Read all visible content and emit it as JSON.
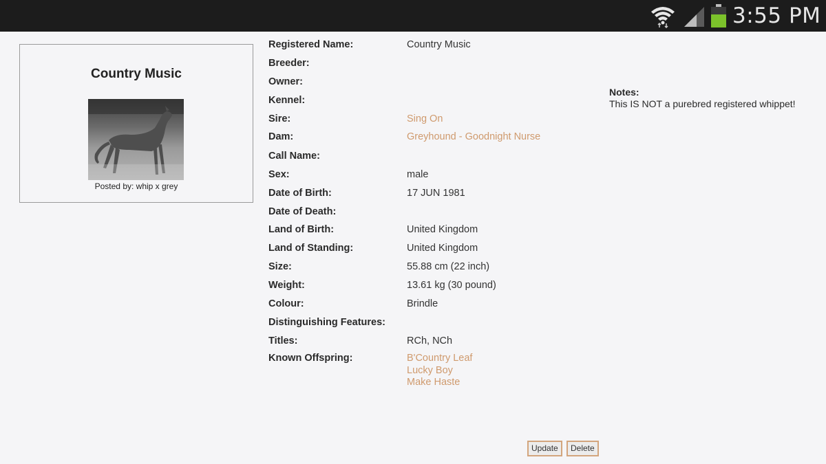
{
  "status_bar": {
    "time": "3:55 PM",
    "icons": [
      "wifi-icon",
      "signal-icon",
      "battery-icon"
    ],
    "battery_color": "#7cc22b"
  },
  "photo_panel": {
    "title": "Country Music",
    "posted_by": "Posted by: whip x grey"
  },
  "details": {
    "registered_name": {
      "label": "Registered Name:",
      "value": "Country Music"
    },
    "breeder": {
      "label": "Breeder:",
      "value": ""
    },
    "owner": {
      "label": "Owner:",
      "value": ""
    },
    "kennel": {
      "label": "Kennel:",
      "value": ""
    },
    "sire": {
      "label": "Sire:",
      "value": "Sing On"
    },
    "dam": {
      "label": "Dam:",
      "value": "Greyhound - Goodnight Nurse"
    },
    "call_name": {
      "label": "Call Name:",
      "value": ""
    },
    "sex": {
      "label": "Sex:",
      "value": "male"
    },
    "date_of_birth": {
      "label": "Date of Birth:",
      "value": "17 JUN 1981"
    },
    "date_of_death": {
      "label": "Date of Death:",
      "value": ""
    },
    "land_of_birth": {
      "label": "Land of Birth:",
      "value": "United Kingdom"
    },
    "land_of_standing": {
      "label": "Land of Standing:",
      "value": "United Kingdom"
    },
    "size": {
      "label": "Size:",
      "value": "55.88 cm (22 inch)"
    },
    "weight": {
      "label": "Weight:",
      "value": "13.61 kg (30 pound)"
    },
    "colour": {
      "label": "Colour:",
      "value": "Brindle"
    },
    "distinguishing_features": {
      "label": "Distinguishing Features:",
      "value": ""
    },
    "titles": {
      "label": "Titles:",
      "value": "RCh, NCh"
    },
    "known_offspring": {
      "label": "Known Offspring:",
      "items": [
        "B'Country Leaf",
        "Lucky Boy",
        "Make Haste"
      ]
    }
  },
  "notes": {
    "label": "Notes:",
    "text": "This IS NOT a purebred registered whippet!"
  },
  "buttons": {
    "update": "Update",
    "delete": "Delete"
  },
  "colors": {
    "link": "#cf9a6d",
    "button_border": "#d3a57d",
    "background": "#f5f5f7",
    "status_bar": "#1c1c1c"
  }
}
